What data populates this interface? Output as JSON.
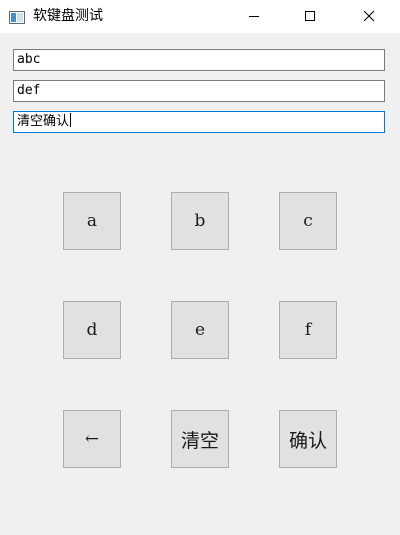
{
  "window": {
    "title": "软键盘测试"
  },
  "inputs": [
    {
      "value": "abc"
    },
    {
      "value": "def"
    },
    {
      "value": "清空确认"
    }
  ],
  "keypad": {
    "row1": [
      "a",
      "b",
      "c"
    ],
    "row2": [
      "d",
      "e",
      "f"
    ],
    "row3": [
      "←",
      "清空",
      "确认"
    ]
  },
  "icons": {
    "app": "window-app-icon",
    "minimize": "minimize-icon",
    "maximize": "maximize-icon",
    "close": "close-icon"
  }
}
